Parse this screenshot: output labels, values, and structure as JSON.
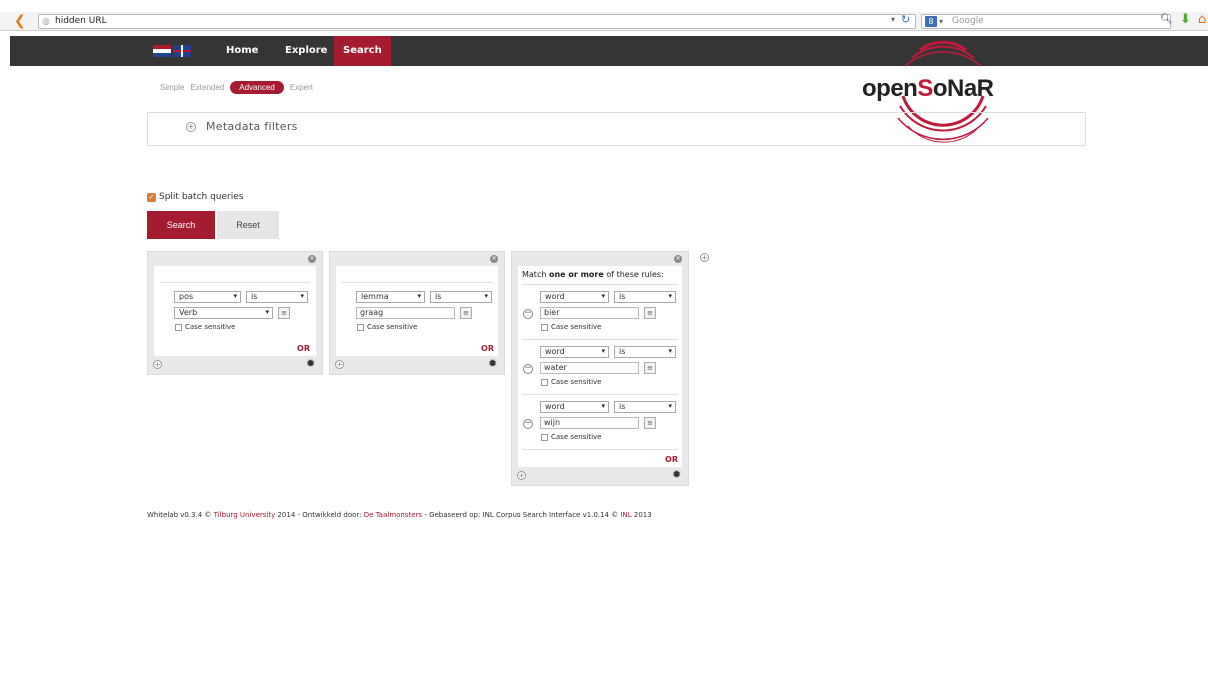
{
  "browser": {
    "url": "hidden URL",
    "search_placeholder": "Google",
    "search_engine_icon": "8"
  },
  "nav": {
    "home": "Home",
    "explore": "Explore",
    "search": "Search"
  },
  "logo": {
    "part1": "open",
    "part2": "S",
    "part3": "oNaR"
  },
  "tabs": {
    "simple": "Simple",
    "extended": "Extended",
    "advanced": "Advanced",
    "expert": "Expert"
  },
  "metadata": {
    "label": "Metadata filters"
  },
  "split": {
    "label": "Split batch queries",
    "checked": true
  },
  "buttons": {
    "search": "Search",
    "reset": "Reset"
  },
  "case_label": "Case sensitive",
  "or_label": "OR",
  "match": {
    "prefix": "Match ",
    "bold": "one or more",
    "suffix": " of these rules:"
  },
  "token1": {
    "field": "pos",
    "op": "is",
    "value": "Verb"
  },
  "token2": {
    "field": "lemma",
    "op": "is",
    "value": "graag"
  },
  "token3": [
    {
      "field": "word",
      "op": "is",
      "value": "bier"
    },
    {
      "field": "word",
      "op": "is",
      "value": "water"
    },
    {
      "field": "word",
      "op": "is",
      "value": "wijn"
    }
  ],
  "footer": {
    "t1": "Whitelab v0.3.4 © ",
    "l1": "Tilburg University",
    "t2": " 2014 - Ontwikkeld door: ",
    "l2": "De Taalmonsters",
    "t3": " - Gebaseerd op: INL Corpus Search Interface v1.0.14 © ",
    "l3": "INL",
    "t4": " 2013"
  },
  "colors": {
    "accent": "#a51c30",
    "nav_bg": "#353535"
  }
}
